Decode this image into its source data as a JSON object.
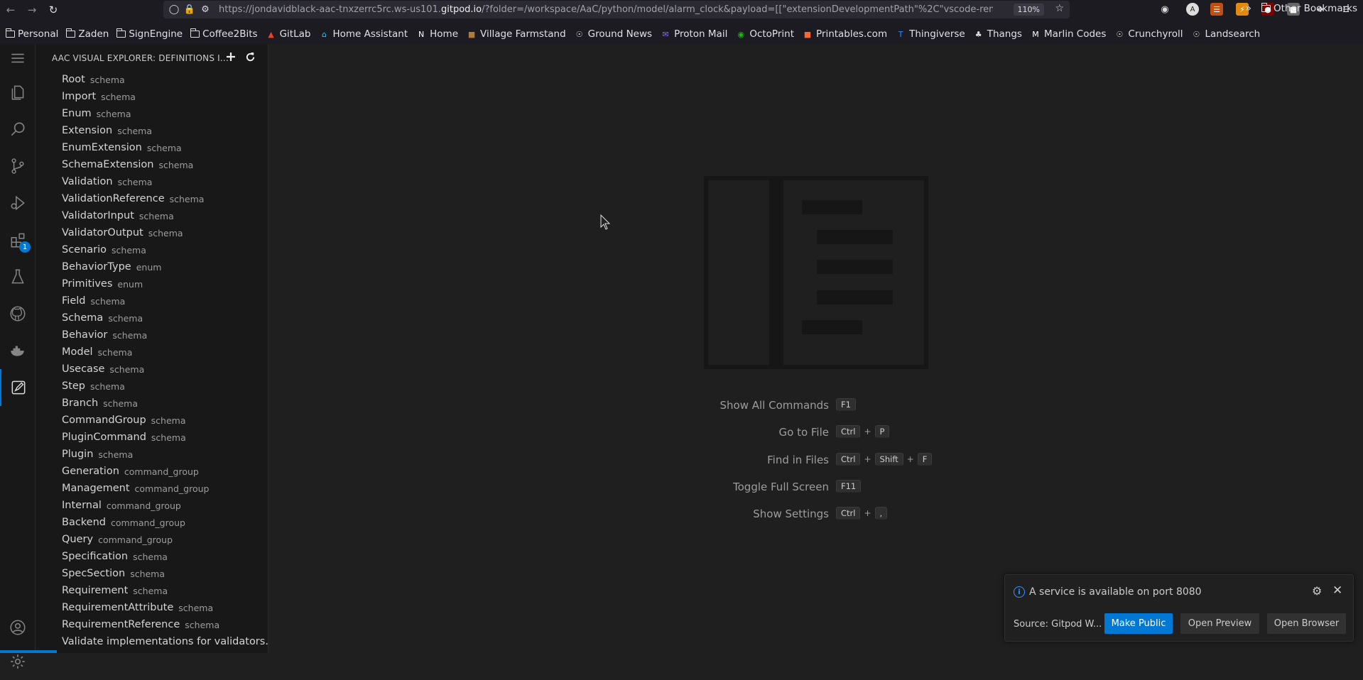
{
  "browser": {
    "url_prefix": "https://jondavidblack-aac-tnxzerrc5rc.ws-us101.",
    "url_domain": "gitpod.io",
    "url_suffix": "/?folder=/workspace/AaC/python/model/alarm_clock&payload=[[\"extensionDevelopmentPath\"%2C\"vscode-rem",
    "zoom": "110%",
    "bookmarks": [
      {
        "label": "Personal",
        "icon": "folder-icon"
      },
      {
        "label": "Zaden",
        "icon": "folder-icon"
      },
      {
        "label": "SignEngine",
        "icon": "folder-icon"
      },
      {
        "label": "Coffee2Bits",
        "icon": "folder-icon"
      },
      {
        "label": "GitLab",
        "icon": "gitlab-icon"
      },
      {
        "label": "Home Assistant",
        "icon": "home-assistant-icon"
      },
      {
        "label": "Home",
        "icon": "notion-icon"
      },
      {
        "label": "Village Farmstand",
        "icon": "farm-icon"
      },
      {
        "label": "Ground News",
        "icon": "globe-icon"
      },
      {
        "label": "Proton Mail",
        "icon": "mail-icon"
      },
      {
        "label": "OctoPrint",
        "icon": "octoprint-icon"
      },
      {
        "label": "Printables.com",
        "icon": "printables-icon"
      },
      {
        "label": "Thingiverse",
        "icon": "thingiverse-icon"
      },
      {
        "label": "Thangs",
        "icon": "thangs-icon"
      },
      {
        "label": "Marlin Codes",
        "icon": "marlin-icon"
      },
      {
        "label": "Crunchyroll",
        "icon": "globe-icon"
      },
      {
        "label": "Landsearch",
        "icon": "globe-icon"
      }
    ],
    "other_bookmarks": "Other Bookmarks"
  },
  "sidebar": {
    "title": "AAC VISUAL EXPLORER: DEFINITIONS I...",
    "items": [
      {
        "name": "Root",
        "kind": "schema"
      },
      {
        "name": "Import",
        "kind": "schema"
      },
      {
        "name": "Enum",
        "kind": "schema"
      },
      {
        "name": "Extension",
        "kind": "schema"
      },
      {
        "name": "EnumExtension",
        "kind": "schema"
      },
      {
        "name": "SchemaExtension",
        "kind": "schema"
      },
      {
        "name": "Validation",
        "kind": "schema"
      },
      {
        "name": "ValidationReference",
        "kind": "schema"
      },
      {
        "name": "ValidatorInput",
        "kind": "schema"
      },
      {
        "name": "ValidatorOutput",
        "kind": "schema"
      },
      {
        "name": "Scenario",
        "kind": "schema"
      },
      {
        "name": "BehaviorType",
        "kind": "enum"
      },
      {
        "name": "Primitives",
        "kind": "enum"
      },
      {
        "name": "Field",
        "kind": "schema"
      },
      {
        "name": "Schema",
        "kind": "schema"
      },
      {
        "name": "Behavior",
        "kind": "schema"
      },
      {
        "name": "Model",
        "kind": "schema"
      },
      {
        "name": "Usecase",
        "kind": "schema"
      },
      {
        "name": "Step",
        "kind": "schema"
      },
      {
        "name": "Branch",
        "kind": "schema"
      },
      {
        "name": "CommandGroup",
        "kind": "schema"
      },
      {
        "name": "PluginCommand",
        "kind": "schema"
      },
      {
        "name": "Plugin",
        "kind": "schema"
      },
      {
        "name": "Generation",
        "kind": "command_group"
      },
      {
        "name": "Management",
        "kind": "command_group"
      },
      {
        "name": "Internal",
        "kind": "command_group"
      },
      {
        "name": "Backend",
        "kind": "command_group"
      },
      {
        "name": "Query",
        "kind": "command_group"
      },
      {
        "name": "Specification",
        "kind": "schema"
      },
      {
        "name": "SpecSection",
        "kind": "schema"
      },
      {
        "name": "Requirement",
        "kind": "schema"
      },
      {
        "name": "RequirementAttribute",
        "kind": "schema"
      },
      {
        "name": "RequirementReference",
        "kind": "schema"
      },
      {
        "name": "Validate implementations for validators...",
        "kind": ""
      }
    ]
  },
  "activity_badge": "1",
  "commands": [
    {
      "label": "Show All Commands",
      "keys": [
        "F1"
      ]
    },
    {
      "label": "Go to File",
      "keys": [
        "Ctrl",
        "P"
      ]
    },
    {
      "label": "Find in Files",
      "keys": [
        "Ctrl",
        "Shift",
        "F"
      ]
    },
    {
      "label": "Toggle Full Screen",
      "keys": [
        "F11"
      ]
    },
    {
      "label": "Show Settings",
      "keys": [
        "Ctrl",
        ","
      ]
    }
  ],
  "notification": {
    "message": "A service is available on port 8080",
    "source": "Source: Gitpod W...",
    "make_public": "Make Public",
    "open_preview": "Open Preview",
    "open_browser": "Open Browser"
  }
}
